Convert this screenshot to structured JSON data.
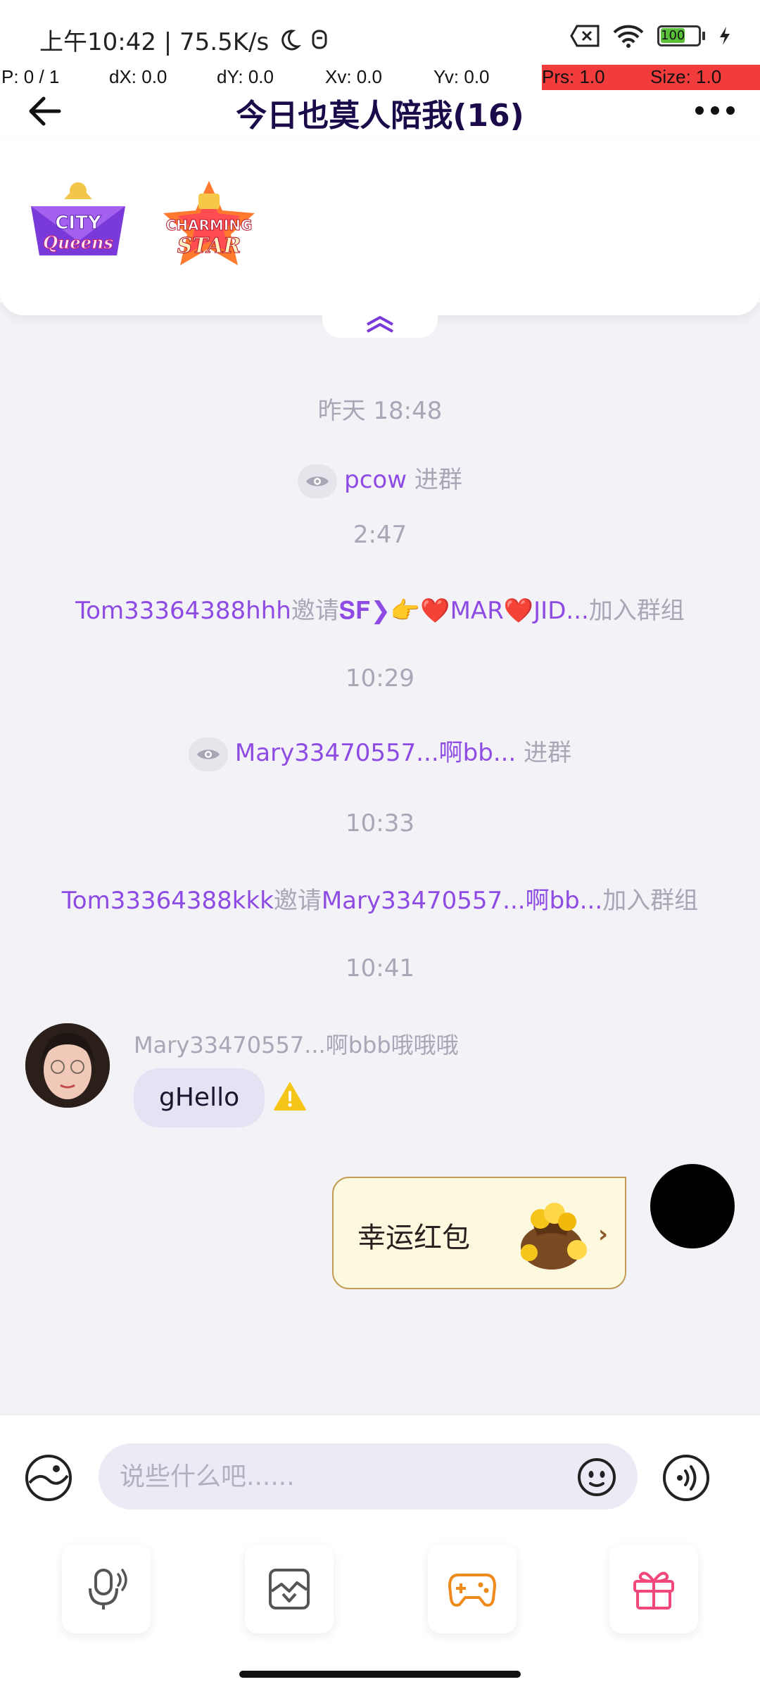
{
  "status_bar": {
    "time": "上午10:42 | 75.5K/s",
    "battery": "100"
  },
  "debug_bar": {
    "p": "P: 0 / 1",
    "dx": "dX: 0.0",
    "dy": "dY: 0.0",
    "xv": "Xv: 0.0",
    "yv": "Yv: 0.0",
    "prs": "Prs: 1.0",
    "size": "Size: 1.0"
  },
  "header": {
    "title": "今日也莫人陪我(16)"
  },
  "badges": [
    {
      "name": "city-queens-badge",
      "lines": [
        "CITY",
        "Queens"
      ]
    },
    {
      "name": "charming-star-badge",
      "lines": [
        "CHARMING",
        "STAR"
      ]
    }
  ],
  "messages": {
    "t1": "昨天 18:48",
    "join1_user": "pcow",
    "join_label": " 进群",
    "t2": "2:47",
    "invite1_inviter": "Tom33364388hhh",
    "invite_word": "邀请",
    "invite1_invitee": "𝐒𝐅❯👉❤️MAR❤️JID...",
    "invite_suffix": "加入群组",
    "t3": "10:29",
    "join2_user": "Mary33470557...啊bb...",
    "t4": "10:33",
    "invite2_inviter": "Tom33364388kkk",
    "invite2_invitee": "Mary33470557...啊bb...",
    "t5": "10:41",
    "sender_name": "Mary33470557...啊bbb哦哦哦",
    "chat_text": "gHello",
    "red_packet_label": "幸运红包"
  },
  "input": {
    "placeholder": "说些什么吧......"
  },
  "colors": {
    "accent": "#8e4be4",
    "title": "#1a0a4a",
    "system_text": "#a9a6b6",
    "bubble": "#e4e3f3",
    "red_packet_bg": "#fdf9de"
  },
  "icons": [
    "back-arrow-icon",
    "more-icon",
    "collapse-chevron-icon",
    "eye-icon",
    "warning-icon",
    "sticker-icon",
    "emoji-icon",
    "voice-wave-icon",
    "microphone-icon",
    "photo-icon",
    "gamepad-icon",
    "gift-icon"
  ]
}
